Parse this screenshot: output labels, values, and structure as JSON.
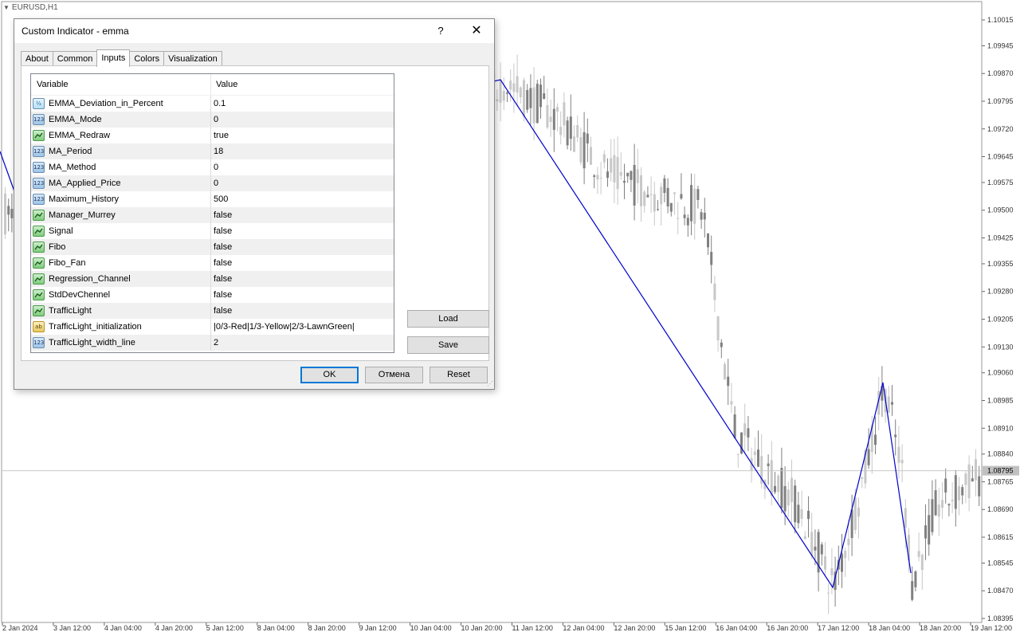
{
  "chart": {
    "symbol": "EURUSD,H1",
    "price_labels": [
      "1.10015",
      "1.09945",
      "1.09870",
      "1.09795",
      "1.09720",
      "1.09645",
      "1.09575",
      "1.09500",
      "1.09425",
      "1.09355",
      "1.09280",
      "1.09205",
      "1.09130",
      "1.09060",
      "1.08985",
      "1.08910",
      "1.08840",
      "1.08765",
      "1.08690",
      "1.08615",
      "1.08545",
      "1.08470",
      "1.08395"
    ],
    "current_price": "1.08795",
    "time_labels": [
      "2 Jan 2024",
      "3 Jan 12:00",
      "4 Jan 04:00",
      "4 Jan 20:00",
      "5 Jan 12:00",
      "8 Jan 04:00",
      "8 Jan 20:00",
      "9 Jan 12:00",
      "10 Jan 04:00",
      "10 Jan 20:00",
      "11 Jan 12:00",
      "12 Jan 04:00",
      "12 Jan 20:00",
      "15 Jan 12:00",
      "16 Jan 04:00",
      "16 Jan 20:00",
      "17 Jan 12:00",
      "18 Jan 04:00",
      "18 Jan 20:00",
      "19 Jan 12:00"
    ],
    "colors": {
      "zigzag": "#0000cc",
      "bull": "#c8c8c8",
      "bear": "#808080",
      "grid": "#d8d8d8"
    }
  },
  "dialog": {
    "title": "Custom Indicator - emma",
    "help_label": "?",
    "close_label": "✕",
    "tabs": [
      {
        "label": "About",
        "active": false
      },
      {
        "label": "Common",
        "active": false
      },
      {
        "label": "Inputs",
        "active": true
      },
      {
        "label": "Colors",
        "active": false
      },
      {
        "label": "Visualization",
        "active": false
      }
    ],
    "grid": {
      "header_variable": "Variable",
      "header_value": "Value",
      "rows": [
        {
          "type": "dbl",
          "icon_text": "½",
          "name": "EMMA_Deviation_in_Percent",
          "value": "0.1"
        },
        {
          "type": "int",
          "icon_text": "123",
          "name": "EMMA_Mode",
          "value": "0"
        },
        {
          "type": "bool",
          "icon_text": "",
          "name": "EMMA_Redraw",
          "value": "true"
        },
        {
          "type": "int",
          "icon_text": "123",
          "name": "MA_Period",
          "value": "18"
        },
        {
          "type": "int",
          "icon_text": "123",
          "name": "MA_Method",
          "value": "0"
        },
        {
          "type": "int",
          "icon_text": "123",
          "name": "MA_Applied_Price",
          "value": "0"
        },
        {
          "type": "int",
          "icon_text": "123",
          "name": "Maximum_History",
          "value": "500"
        },
        {
          "type": "bool",
          "icon_text": "",
          "name": "Manager_Murrey",
          "value": "false"
        },
        {
          "type": "bool",
          "icon_text": "",
          "name": "Signal",
          "value": "false"
        },
        {
          "type": "bool",
          "icon_text": "",
          "name": "Fibo",
          "value": "false"
        },
        {
          "type": "bool",
          "icon_text": "",
          "name": "Fibo_Fan",
          "value": "false"
        },
        {
          "type": "bool",
          "icon_text": "",
          "name": "Regression_Channel",
          "value": "false"
        },
        {
          "type": "bool",
          "icon_text": "",
          "name": "StdDevChennel",
          "value": "false"
        },
        {
          "type": "bool",
          "icon_text": "",
          "name": "TrafficLight",
          "value": "false"
        },
        {
          "type": "str",
          "icon_text": "ab",
          "name": "TrafficLight_initialization",
          "value": "|0/3-Red|1/3-Yellow|2/3-LawnGreen|"
        },
        {
          "type": "int",
          "icon_text": "123",
          "name": "TrafficLight_width_line",
          "value": "2"
        }
      ]
    },
    "load_label": "Load",
    "save_label": "Save",
    "ok_label": "OK",
    "cancel_label": "Отмена",
    "reset_label": "Reset"
  }
}
